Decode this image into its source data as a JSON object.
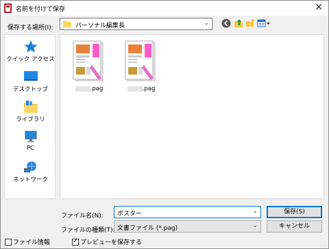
{
  "window": {
    "title": "名前を付けて保存",
    "close_glyph": "✕"
  },
  "location": {
    "label": "保存する場所(I):",
    "value": "パーソナル編集長"
  },
  "toolbar": {
    "back_icon": "back-arrow-icon",
    "up_icon": "up-folder-icon",
    "new_folder_icon": "new-folder-icon",
    "view_icon": "view-menu-icon"
  },
  "places": [
    {
      "label": "クイック アクセス",
      "icon": "star-icon"
    },
    {
      "label": "デスクトップ",
      "icon": "desktop-icon"
    },
    {
      "label": "ライブラリ",
      "icon": "library-icon"
    },
    {
      "label": "PC",
      "icon": "pc-icon"
    },
    {
      "label": "ネットワーク",
      "icon": "network-icon"
    }
  ],
  "files": [
    {
      "name_suffix": ".pag"
    },
    {
      "name_suffix": ".pag"
    }
  ],
  "filename": {
    "label": "ファイル名(N):",
    "value": "ポスター"
  },
  "filetype": {
    "label": "ファイルの種類(T):",
    "value": "文書ファイル (*.pag)"
  },
  "buttons": {
    "save": "保存(S)",
    "cancel": "キャンセル"
  },
  "options": {
    "file_info": {
      "label": "ファイル情報",
      "checked": false
    },
    "save_preview": {
      "label": "プレビューを保存する",
      "checked": true
    }
  },
  "colors": {
    "accent": "#0078d7",
    "folder": "#f5c84c"
  }
}
